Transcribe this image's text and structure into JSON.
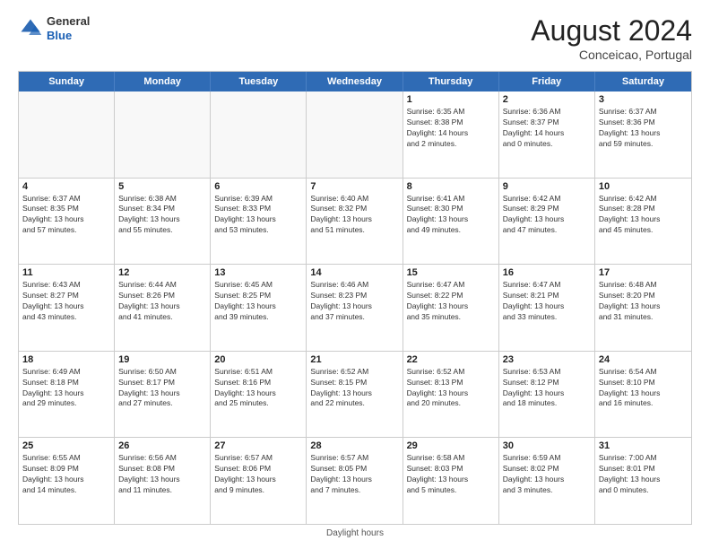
{
  "header": {
    "logo_general": "General",
    "logo_blue": "Blue",
    "month_year": "August 2024",
    "location": "Conceicao, Portugal"
  },
  "days_of_week": [
    "Sunday",
    "Monday",
    "Tuesday",
    "Wednesday",
    "Thursday",
    "Friday",
    "Saturday"
  ],
  "footer": {
    "daylight_hours": "Daylight hours"
  },
  "weeks": [
    [
      {
        "day": "",
        "info": ""
      },
      {
        "day": "",
        "info": ""
      },
      {
        "day": "",
        "info": ""
      },
      {
        "day": "",
        "info": ""
      },
      {
        "day": "1",
        "info": "Sunrise: 6:35 AM\nSunset: 8:38 PM\nDaylight: 14 hours\nand 2 minutes."
      },
      {
        "day": "2",
        "info": "Sunrise: 6:36 AM\nSunset: 8:37 PM\nDaylight: 14 hours\nand 0 minutes."
      },
      {
        "day": "3",
        "info": "Sunrise: 6:37 AM\nSunset: 8:36 PM\nDaylight: 13 hours\nand 59 minutes."
      }
    ],
    [
      {
        "day": "4",
        "info": "Sunrise: 6:37 AM\nSunset: 8:35 PM\nDaylight: 13 hours\nand 57 minutes."
      },
      {
        "day": "5",
        "info": "Sunrise: 6:38 AM\nSunset: 8:34 PM\nDaylight: 13 hours\nand 55 minutes."
      },
      {
        "day": "6",
        "info": "Sunrise: 6:39 AM\nSunset: 8:33 PM\nDaylight: 13 hours\nand 53 minutes."
      },
      {
        "day": "7",
        "info": "Sunrise: 6:40 AM\nSunset: 8:32 PM\nDaylight: 13 hours\nand 51 minutes."
      },
      {
        "day": "8",
        "info": "Sunrise: 6:41 AM\nSunset: 8:30 PM\nDaylight: 13 hours\nand 49 minutes."
      },
      {
        "day": "9",
        "info": "Sunrise: 6:42 AM\nSunset: 8:29 PM\nDaylight: 13 hours\nand 47 minutes."
      },
      {
        "day": "10",
        "info": "Sunrise: 6:42 AM\nSunset: 8:28 PM\nDaylight: 13 hours\nand 45 minutes."
      }
    ],
    [
      {
        "day": "11",
        "info": "Sunrise: 6:43 AM\nSunset: 8:27 PM\nDaylight: 13 hours\nand 43 minutes."
      },
      {
        "day": "12",
        "info": "Sunrise: 6:44 AM\nSunset: 8:26 PM\nDaylight: 13 hours\nand 41 minutes."
      },
      {
        "day": "13",
        "info": "Sunrise: 6:45 AM\nSunset: 8:25 PM\nDaylight: 13 hours\nand 39 minutes."
      },
      {
        "day": "14",
        "info": "Sunrise: 6:46 AM\nSunset: 8:23 PM\nDaylight: 13 hours\nand 37 minutes."
      },
      {
        "day": "15",
        "info": "Sunrise: 6:47 AM\nSunset: 8:22 PM\nDaylight: 13 hours\nand 35 minutes."
      },
      {
        "day": "16",
        "info": "Sunrise: 6:47 AM\nSunset: 8:21 PM\nDaylight: 13 hours\nand 33 minutes."
      },
      {
        "day": "17",
        "info": "Sunrise: 6:48 AM\nSunset: 8:20 PM\nDaylight: 13 hours\nand 31 minutes."
      }
    ],
    [
      {
        "day": "18",
        "info": "Sunrise: 6:49 AM\nSunset: 8:18 PM\nDaylight: 13 hours\nand 29 minutes."
      },
      {
        "day": "19",
        "info": "Sunrise: 6:50 AM\nSunset: 8:17 PM\nDaylight: 13 hours\nand 27 minutes."
      },
      {
        "day": "20",
        "info": "Sunrise: 6:51 AM\nSunset: 8:16 PM\nDaylight: 13 hours\nand 25 minutes."
      },
      {
        "day": "21",
        "info": "Sunrise: 6:52 AM\nSunset: 8:15 PM\nDaylight: 13 hours\nand 22 minutes."
      },
      {
        "day": "22",
        "info": "Sunrise: 6:52 AM\nSunset: 8:13 PM\nDaylight: 13 hours\nand 20 minutes."
      },
      {
        "day": "23",
        "info": "Sunrise: 6:53 AM\nSunset: 8:12 PM\nDaylight: 13 hours\nand 18 minutes."
      },
      {
        "day": "24",
        "info": "Sunrise: 6:54 AM\nSunset: 8:10 PM\nDaylight: 13 hours\nand 16 minutes."
      }
    ],
    [
      {
        "day": "25",
        "info": "Sunrise: 6:55 AM\nSunset: 8:09 PM\nDaylight: 13 hours\nand 14 minutes."
      },
      {
        "day": "26",
        "info": "Sunrise: 6:56 AM\nSunset: 8:08 PM\nDaylight: 13 hours\nand 11 minutes."
      },
      {
        "day": "27",
        "info": "Sunrise: 6:57 AM\nSunset: 8:06 PM\nDaylight: 13 hours\nand 9 minutes."
      },
      {
        "day": "28",
        "info": "Sunrise: 6:57 AM\nSunset: 8:05 PM\nDaylight: 13 hours\nand 7 minutes."
      },
      {
        "day": "29",
        "info": "Sunrise: 6:58 AM\nSunset: 8:03 PM\nDaylight: 13 hours\nand 5 minutes."
      },
      {
        "day": "30",
        "info": "Sunrise: 6:59 AM\nSunset: 8:02 PM\nDaylight: 13 hours\nand 3 minutes."
      },
      {
        "day": "31",
        "info": "Sunrise: 7:00 AM\nSunset: 8:01 PM\nDaylight: 13 hours\nand 0 minutes."
      }
    ]
  ]
}
